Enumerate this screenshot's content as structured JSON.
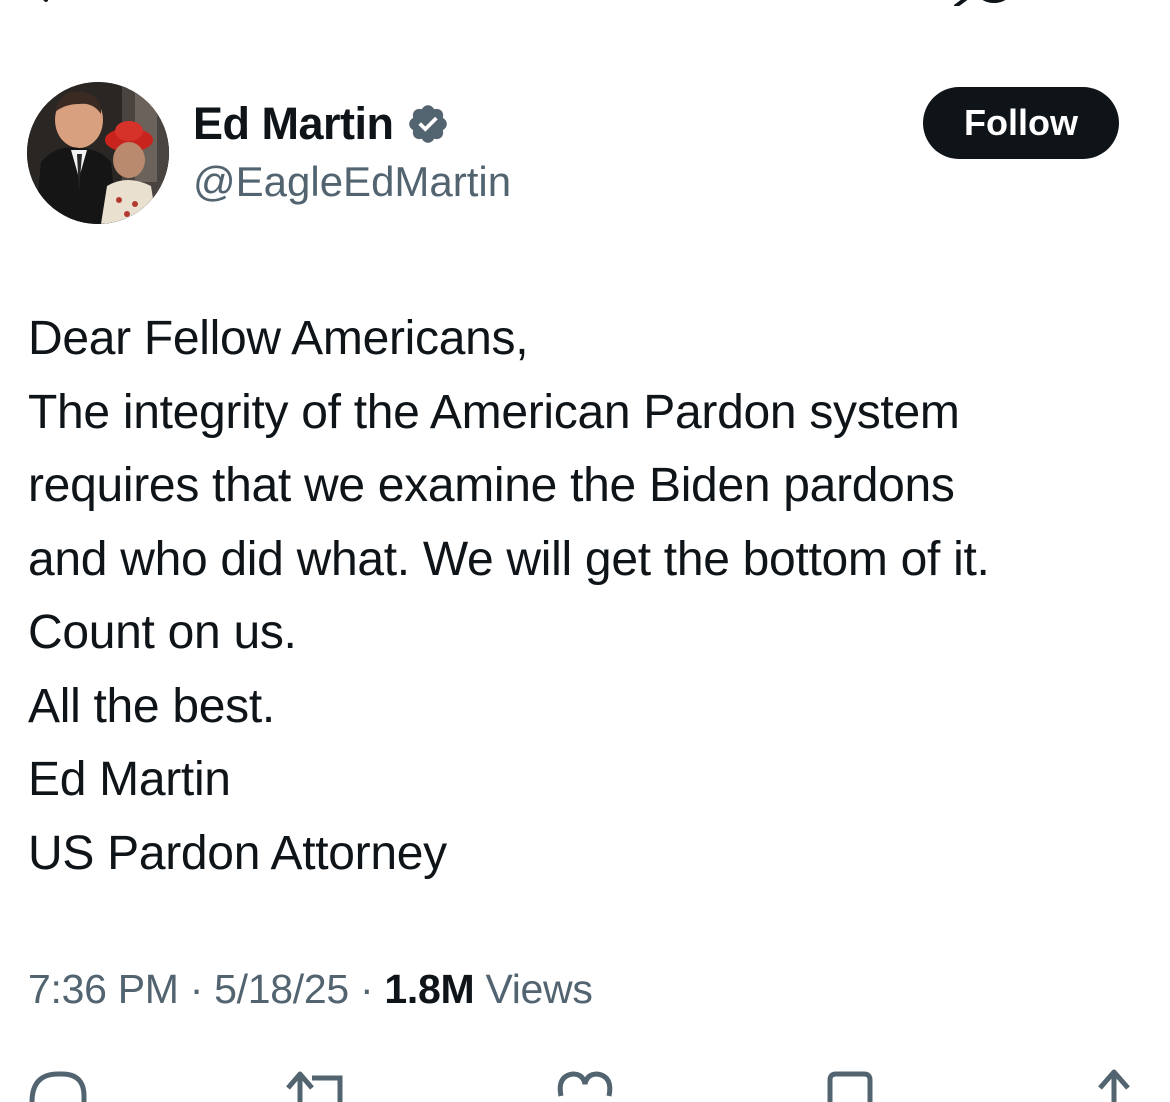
{
  "top_bar": {
    "back_icon": "arrow-left-icon",
    "grok_icon": "grok-icon"
  },
  "author": {
    "name": "Ed Martin",
    "handle": "@EagleEdMartin",
    "verified": true,
    "verified_icon": "verified-badge-icon",
    "avatar_icon": "profile-photo"
  },
  "follow_button": {
    "label": "Follow"
  },
  "tweet": {
    "lines": [
      "Dear Fellow Americans,",
      "The integrity of the American Pardon system",
      "requires that we examine the Biden pardons",
      "and who did what. We will get the bottom of it.",
      "Count on us.",
      "All the best.",
      "Ed Martin",
      "US Pardon Attorney"
    ]
  },
  "meta": {
    "time": "7:36 PM",
    "separator": "·",
    "date": "5/18/25",
    "views_count": "1.8M",
    "views_label": "Views"
  },
  "actions": {
    "reply_icon": "reply-icon",
    "repost_icon": "repost-icon",
    "like_icon": "heart-icon",
    "bookmark_icon": "bookmark-icon",
    "share_icon": "share-icon"
  },
  "colors": {
    "text_primary": "#0f1419",
    "text_secondary": "#536471",
    "verified_blue": "#1d9bf0",
    "button_bg": "#0f1419"
  }
}
